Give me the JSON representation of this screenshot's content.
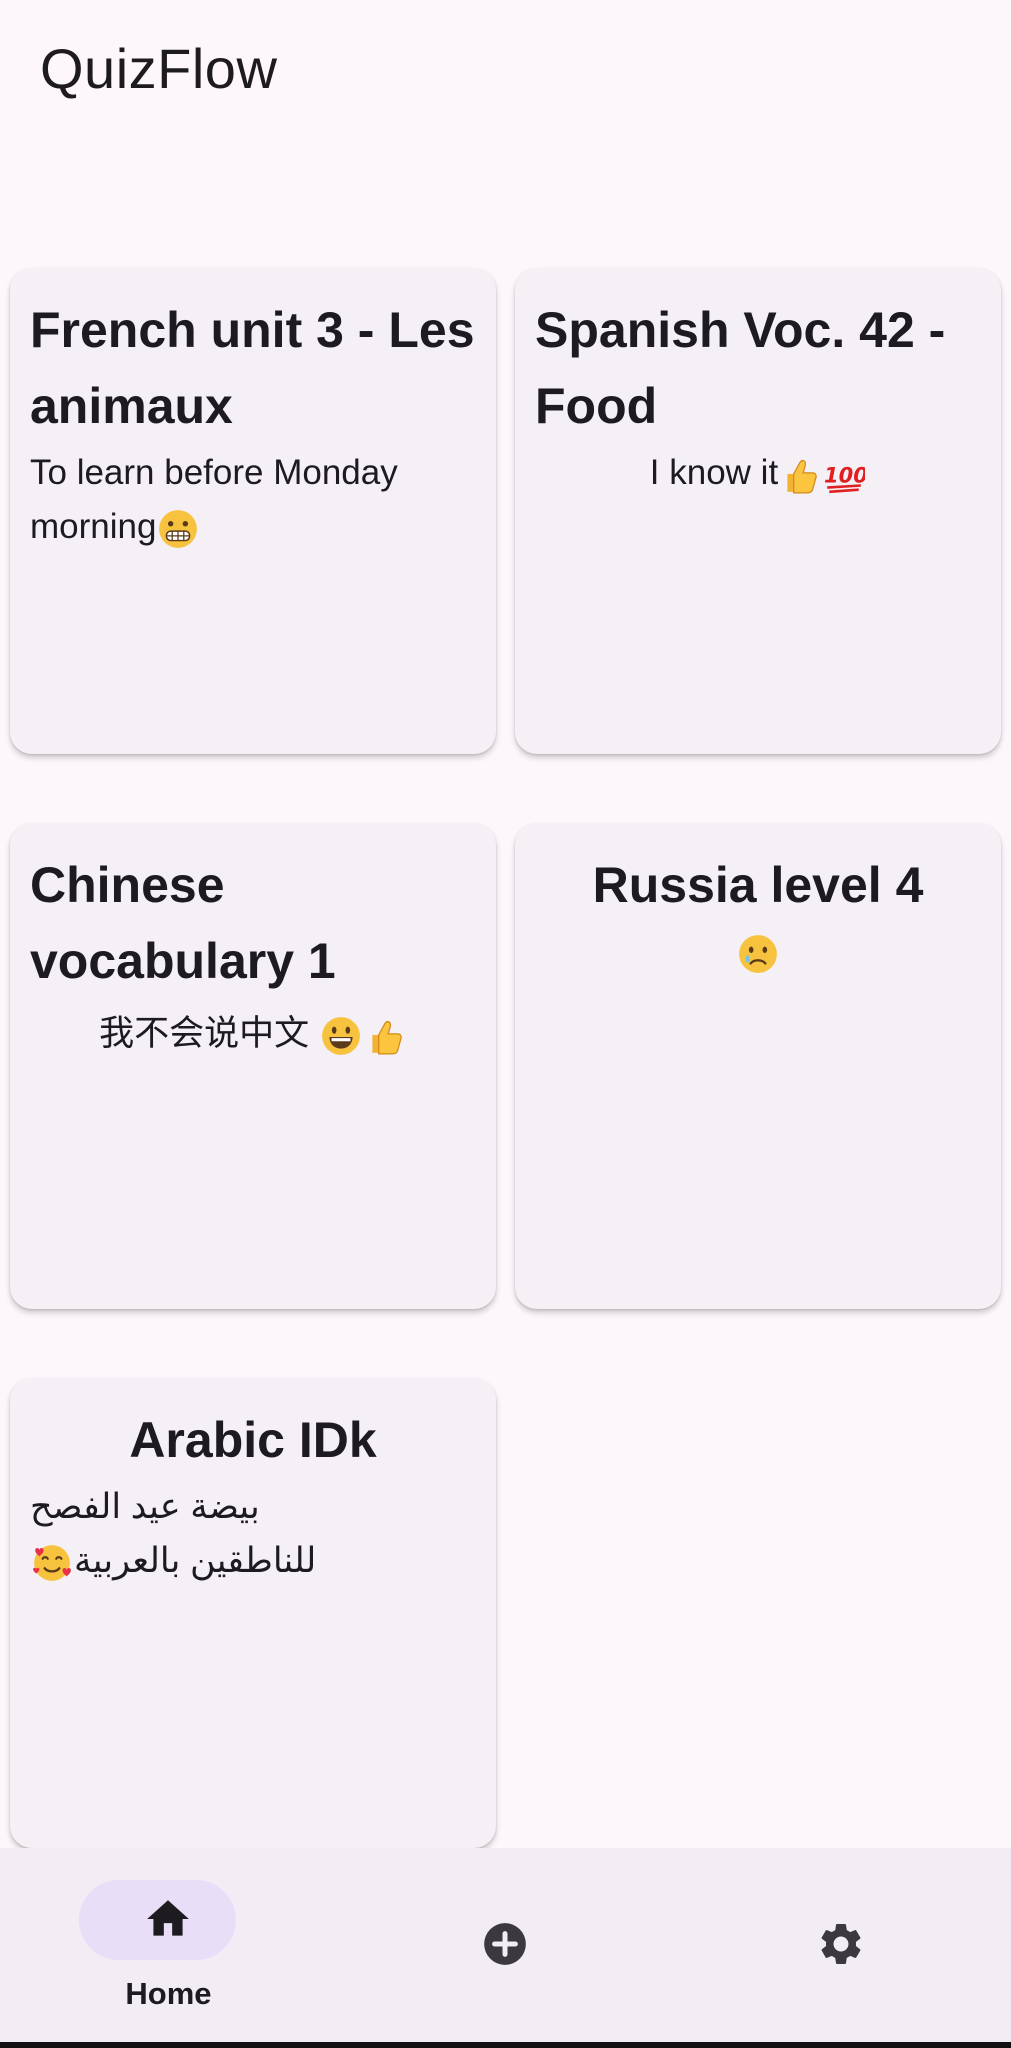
{
  "app": {
    "title": "QuizFlow"
  },
  "quizzes": [
    {
      "title": "French unit 3 - Les animaux",
      "subtitle": "To learn before Monday morning",
      "subtitle_emojis": [
        "grimacing-face"
      ]
    },
    {
      "title": "Spanish Voc. 42 - Food",
      "subtitle": "I know it",
      "subtitle_emojis": [
        "thumbs-up",
        "hundred-points"
      ]
    },
    {
      "title": "Chinese vocabulary 1",
      "subtitle": "我不会说中文 ",
      "subtitle_emojis": [
        "grinning-face",
        "thumbs-up"
      ]
    },
    {
      "title": "Russia level 4",
      "subtitle": "",
      "subtitle_emojis": [
        "crying-face"
      ]
    },
    {
      "title": "Arabic IDk",
      "subtitle": "بيضة عيد الفصح للناطقين بالعربية",
      "subtitle_emojis": [
        "smiling-face-with-hearts"
      ]
    }
  ],
  "bottom_nav": {
    "items": [
      {
        "label": "Home",
        "icon": "home-icon",
        "selected": true
      },
      {
        "label": "",
        "icon": "add-circle-icon",
        "selected": false
      },
      {
        "label": "",
        "icon": "gear-icon",
        "selected": false
      }
    ]
  },
  "colors": {
    "background": "#fdf7fc",
    "card": "#f5eff6",
    "nav_background": "#f2ecf5",
    "nav_selected_pill": "#e8def8",
    "text": "#1d1b20",
    "icon": "#3b383e"
  }
}
